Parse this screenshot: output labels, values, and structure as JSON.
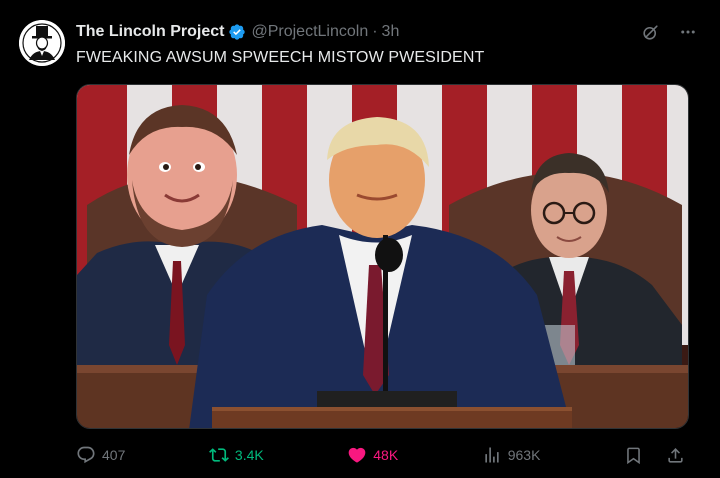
{
  "author": {
    "name": "The Lincoln Project",
    "handle": "@ProjectLincoln",
    "time": "3h",
    "separator": "·",
    "verified": true,
    "avatar_icon": "lincoln-portrait-icon"
  },
  "tweet": {
    "text": "FWEAKING AWSUM SPWEECH MISTOW PWESIDENT"
  },
  "media": {
    "type": "photo",
    "scene": "three men at a podium before a large american flag"
  },
  "actions": {
    "replies": "407",
    "reposts": "3.4K",
    "likes": "48K",
    "views": "963K",
    "liked": true
  },
  "colors": {
    "background": "#000000",
    "text": "#e7e9ea",
    "muted": "#71767b",
    "verified": "#1d9bf0",
    "repost": "#00ba7c",
    "like": "#f91880"
  }
}
